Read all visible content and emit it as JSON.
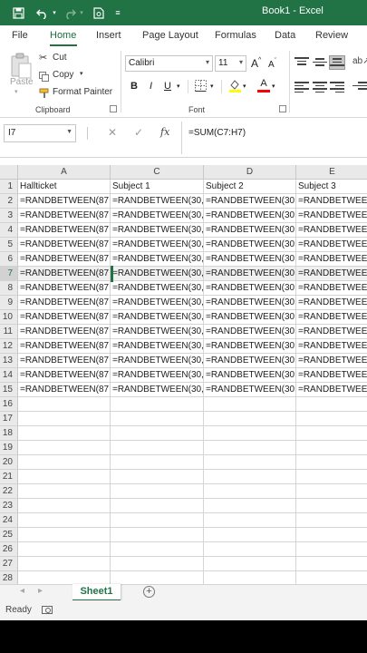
{
  "titlebar": {
    "title": "Book1  -  Excel",
    "icons": [
      "save-icon",
      "undo-icon",
      "redo-icon",
      "print-preview-icon",
      "customize-qat-icon"
    ]
  },
  "ribbon_tabs": [
    {
      "label": "File",
      "active": false
    },
    {
      "label": "Home",
      "active": true
    },
    {
      "label": "Insert",
      "active": false
    },
    {
      "label": "Page Layout",
      "active": false
    },
    {
      "label": "Formulas",
      "active": false
    },
    {
      "label": "Data",
      "active": false
    },
    {
      "label": "Review",
      "active": false
    }
  ],
  "clipboard": {
    "paste_label": "Paste",
    "cut_label": "Cut",
    "copy_label": "Copy",
    "format_painter_label": "Format Painter",
    "group_label": "Clipboard"
  },
  "font": {
    "font_name": "Calibri",
    "font_size": "11",
    "increase_size": "A",
    "decrease_size": "A",
    "bold": "B",
    "italic": "I",
    "underline": "U",
    "highlight_glyph": "ab",
    "font_color_glyph": "A",
    "highlight_color": "#ffff00",
    "font_color": "#ff0000",
    "group_label": "Font"
  },
  "formula_bar": {
    "name_box": "I7",
    "cancel": "✕",
    "enter": "✓",
    "fx": "fx",
    "formula": "=SUM(C7:H7)"
  },
  "sheet": {
    "columns": [
      "A",
      "C",
      "D",
      "E"
    ],
    "rows": [
      "1",
      "2",
      "3",
      "4",
      "5",
      "6",
      "7",
      "8",
      "9",
      "10",
      "11",
      "12",
      "13",
      "14",
      "15",
      "16",
      "17",
      "18",
      "19",
      "20",
      "21",
      "22",
      "23",
      "24",
      "25",
      "26",
      "27",
      "28"
    ],
    "selected_row": "7",
    "cells": [
      [
        "Hallticket",
        "Subject 1",
        "Subject 2",
        "Subject 3"
      ],
      [
        "=RANDBETWEEN(87",
        "=RANDBETWEEN(30,",
        "=RANDBETWEEN(30,",
        "=RANDBETWEEN"
      ],
      [
        "=RANDBETWEEN(87",
        "=RANDBETWEEN(30,",
        "=RANDBETWEEN(30,",
        "=RANDBETWEEN"
      ],
      [
        "=RANDBETWEEN(87",
        "=RANDBETWEEN(30,",
        "=RANDBETWEEN(30,",
        "=RANDBETWEEN"
      ],
      [
        "=RANDBETWEEN(87",
        "=RANDBETWEEN(30,",
        "=RANDBETWEEN(30,",
        "=RANDBETWEEN"
      ],
      [
        "=RANDBETWEEN(87",
        "=RANDBETWEEN(30,",
        "=RANDBETWEEN(30,",
        "=RANDBETWEEN"
      ],
      [
        "=RANDBETWEEN(87",
        "=RANDBETWEEN(30,",
        "=RANDBETWEEN(30,",
        "=RANDBETWEEN"
      ],
      [
        "=RANDBETWEEN(87",
        "=RANDBETWEEN(30,",
        "=RANDBETWEEN(30,",
        "=RANDBETWEEN"
      ],
      [
        "=RANDBETWEEN(87",
        "=RANDBETWEEN(30,",
        "=RANDBETWEEN(30,",
        "=RANDBETWEEN"
      ],
      [
        "=RANDBETWEEN(87",
        "=RANDBETWEEN(30,",
        "=RANDBETWEEN(30,",
        "=RANDBETWEEN"
      ],
      [
        "=RANDBETWEEN(87",
        "=RANDBETWEEN(30,",
        "=RANDBETWEEN(30,",
        "=RANDBETWEEN"
      ],
      [
        "=RANDBETWEEN(87",
        "=RANDBETWEEN(30,",
        "=RANDBETWEEN(30,",
        "=RANDBETWEEN"
      ],
      [
        "=RANDBETWEEN(87",
        "=RANDBETWEEN(30,",
        "=RANDBETWEEN(30,",
        "=RANDBETWEEN"
      ],
      [
        "=RANDBETWEEN(87",
        "=RANDBETWEEN(30,",
        "=RANDBETWEEN(30,",
        "=RANDBETWEEN"
      ],
      [
        "=RANDBETWEEN(87",
        "=RANDBETWEEN(30,",
        "=RANDBETWEEN(30,",
        "=RANDBETWEEN"
      ]
    ]
  },
  "sheet_tabs": {
    "prev": "◂",
    "next": "▸",
    "active": "Sheet1",
    "add": "+"
  },
  "status": {
    "text": "Ready"
  },
  "colors": {
    "accent": "#217346"
  }
}
